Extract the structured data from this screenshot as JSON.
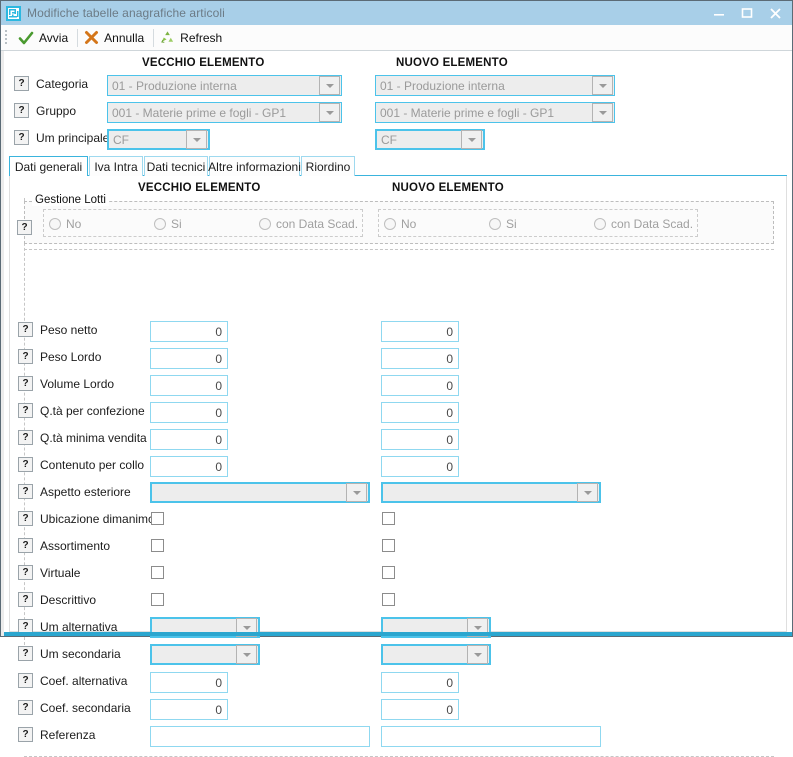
{
  "window": {
    "title": "Modifiche tabelle anagrafiche articoli",
    "icon": "app-maze-icon",
    "buttons": {
      "minimize": "minimize-icon",
      "maximize": "maximize-icon",
      "close": "close-icon"
    },
    "accent_color": "#2ba6cf",
    "titlebar_color": "#a8cfe8"
  },
  "toolbar": {
    "avvia": "Avvia",
    "annulla": "Annulla",
    "refresh": "Refresh"
  },
  "headers": {
    "old": "VECCHIO  ELEMENTO",
    "new": "NUOVO  ELEMENTO"
  },
  "top_fields": [
    {
      "label": "Categoria",
      "old_value": "01 - Produzione interna",
      "new_value": "01 - Produzione interna"
    },
    {
      "label": "Gruppo",
      "old_value": "001 - Materie prime e fogli - GP1",
      "new_value": "001 - Materie prime e fogli - GP1"
    },
    {
      "label": "Um principale",
      "old_value": "CF",
      "new_value": "CF"
    }
  ],
  "tabs": [
    {
      "label": "Dati generali",
      "active": true
    },
    {
      "label": "Iva Intra",
      "active": false
    },
    {
      "label": "Dati tecnici",
      "active": false
    },
    {
      "label": "Altre informazioni",
      "active": false
    },
    {
      "label": "Riordino",
      "active": false
    }
  ],
  "lotti": {
    "group_title": "Gestione Lotti",
    "options": [
      "No",
      "Si",
      "con Data Scad."
    ]
  },
  "fields": [
    {
      "label": "Peso netto",
      "type": "number",
      "old_value": "0",
      "new_value": "0"
    },
    {
      "label": "Peso Lordo",
      "type": "number",
      "old_value": "0",
      "new_value": "0"
    },
    {
      "label": "Volume Lordo",
      "type": "number",
      "old_value": "0",
      "new_value": "0"
    },
    {
      "label": "Q.tà per confezione",
      "type": "number",
      "old_value": "0",
      "new_value": "0"
    },
    {
      "label": "Q.tà minima vendita",
      "type": "number",
      "old_value": "0",
      "new_value": "0"
    },
    {
      "label": "Contenuto per collo",
      "type": "number",
      "old_value": "0",
      "new_value": "0"
    },
    {
      "label": "Aspetto esteriore",
      "type": "combo-wide",
      "old_value": "",
      "new_value": ""
    },
    {
      "label": "Ubicazione dimanimca",
      "type": "checkbox",
      "old_value": "",
      "new_value": ""
    },
    {
      "label": "Assortimento",
      "type": "checkbox",
      "old_value": "",
      "new_value": ""
    },
    {
      "label": "Virtuale",
      "type": "checkbox",
      "old_value": "",
      "new_value": ""
    },
    {
      "label": "Descrittivo",
      "type": "checkbox",
      "old_value": "",
      "new_value": ""
    },
    {
      "label": "Um alternativa",
      "type": "combo-small",
      "old_value": "",
      "new_value": ""
    },
    {
      "label": "Um secondaria",
      "type": "combo-small",
      "old_value": "",
      "new_value": ""
    },
    {
      "label": "Coef. alternativa",
      "type": "number",
      "old_value": "0",
      "new_value": "0"
    },
    {
      "label": "Coef. secondaria",
      "type": "number",
      "old_value": "0",
      "new_value": "0"
    },
    {
      "label": "Referenza",
      "type": "text",
      "old_value": "",
      "new_value": ""
    }
  ],
  "help_glyph": "?"
}
